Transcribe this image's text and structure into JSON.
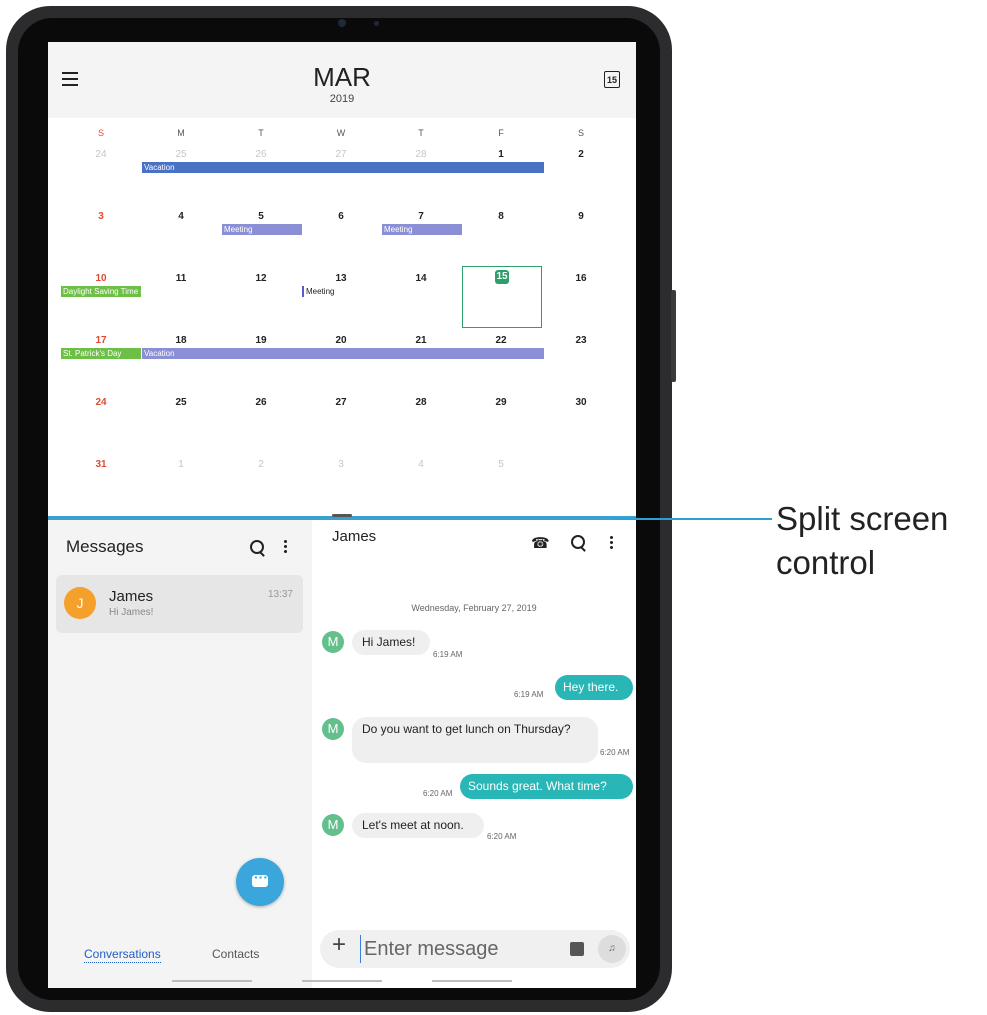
{
  "calendar": {
    "month": "MAR",
    "year": "2019",
    "today_icon": "15",
    "weekdays": [
      "S",
      "M",
      "T",
      "W",
      "T",
      "F",
      "S"
    ],
    "weeks": [
      [
        "24",
        "25",
        "26",
        "27",
        "28",
        "1",
        "2"
      ],
      [
        "3",
        "4",
        "5",
        "6",
        "7",
        "8",
        "9"
      ],
      [
        "10",
        "11",
        "12",
        "13",
        "14",
        "15",
        "16"
      ],
      [
        "17",
        "18",
        "19",
        "20",
        "21",
        "22",
        "23"
      ],
      [
        "24",
        "25",
        "26",
        "27",
        "28",
        "29",
        "30"
      ],
      [
        "31",
        "1",
        "2",
        "3",
        "4",
        "5",
        ""
      ]
    ],
    "events": {
      "vacation_1": "Vacation",
      "meeting_1": "Meeting",
      "meeting_2": "Meeting",
      "meeting_3": "Meeting",
      "dst": "Daylight Saving Time st",
      "st_patricks": "St. Patrick's Day",
      "vacation_2": "Vacation"
    },
    "add_icon": "+"
  },
  "messages": {
    "title": "Messages",
    "conversation": {
      "avatar_letter": "J",
      "name": "James",
      "preview": "Hi James!",
      "time": "13:37"
    },
    "tabs": {
      "conversations": "Conversations",
      "contacts": "Contacts"
    }
  },
  "chat": {
    "contact": "James",
    "date": "Wednesday, February 27, 2019",
    "avatar_letter": "M",
    "thread": [
      {
        "dir": "in",
        "text": "Hi James!",
        "time": "6:19 AM"
      },
      {
        "dir": "out",
        "text": "Hey there.",
        "time": "6:19 AM"
      },
      {
        "dir": "in",
        "text": "Do you want to get lunch on Thursday?",
        "time": "6:20 AM"
      },
      {
        "dir": "out",
        "text": "Sounds great. What time?",
        "time": "6:20 AM"
      },
      {
        "dir": "in",
        "text": "Let's meet at noon.",
        "time": "6:20 AM"
      }
    ],
    "input_placeholder": "Enter message",
    "attach_icon": "+"
  },
  "callout": {
    "text": "Split screen control",
    "color": "#2aa0d6"
  },
  "colors": {
    "accent_green": "#27b07c",
    "today_green": "#2e9e6b",
    "sunday_red": "#e04a35",
    "bubble_teal": "#29b6b6",
    "compose_blue": "#3aa6dc"
  },
  "icons": [
    "menu-icon",
    "calendar-today-icon",
    "add-event-icon",
    "search-icon",
    "more-icon",
    "phone-icon",
    "compose-icon",
    "attach-icon",
    "sticker-icon",
    "voice-icon"
  ]
}
